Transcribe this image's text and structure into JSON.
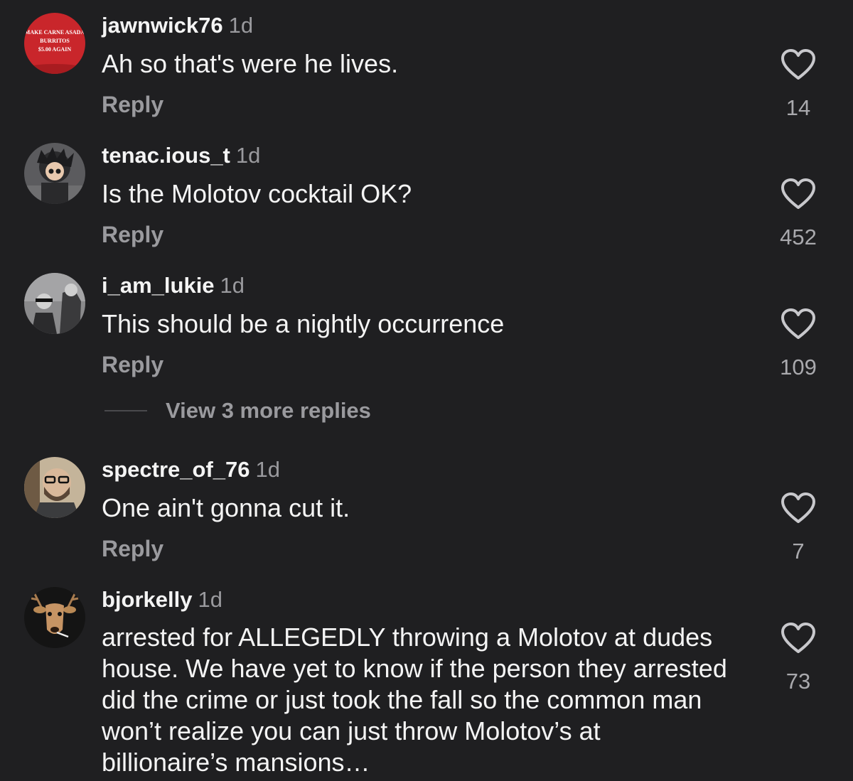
{
  "colors": {
    "background": "#1f1f21",
    "text": "#f4f4f4",
    "muted": "#9a9a9e",
    "heart": "#c8c8cc"
  },
  "comments": [
    {
      "avatar_icon": "red-cap-avatar-icon",
      "avatar_text": [
        "MAKE CARNE ASADA",
        "BURRITOS",
        "$5.00 AGAIN"
      ],
      "username": "jawnwick76",
      "time": "1d",
      "text": "Ah so that's were he lives.",
      "reply": "Reply",
      "likes": "14"
    },
    {
      "avatar_icon": "figure-avatar-icon",
      "username": "tenac.ious_t",
      "time": "1d",
      "text": "Is the Molotov cocktail OK?",
      "reply": "Reply",
      "likes": "452"
    },
    {
      "avatar_icon": "photo-avatar-icon",
      "username": "i_am_lukie",
      "time": "1d",
      "text": "This should be a nightly occurrence",
      "reply": "Reply",
      "likes": "109"
    },
    {
      "avatar_icon": "bearded-man-avatar-icon",
      "username": "spectre_of_76",
      "time": "1d",
      "text": "One ain't gonna cut it.",
      "reply": "Reply",
      "likes": "7"
    },
    {
      "avatar_icon": "deer-avatar-icon",
      "username": "bjorkelly",
      "time": "1d",
      "text": "arrested for ALLEGEDLY throwing a Molotov at dudes house. We have yet to know if the person they arrested did the crime or just took the fall so the common man won’t realize you can just throw Molotov’s at billionaire’s mansions…",
      "likes": "73"
    }
  ],
  "view_more_replies": "View 3 more replies"
}
